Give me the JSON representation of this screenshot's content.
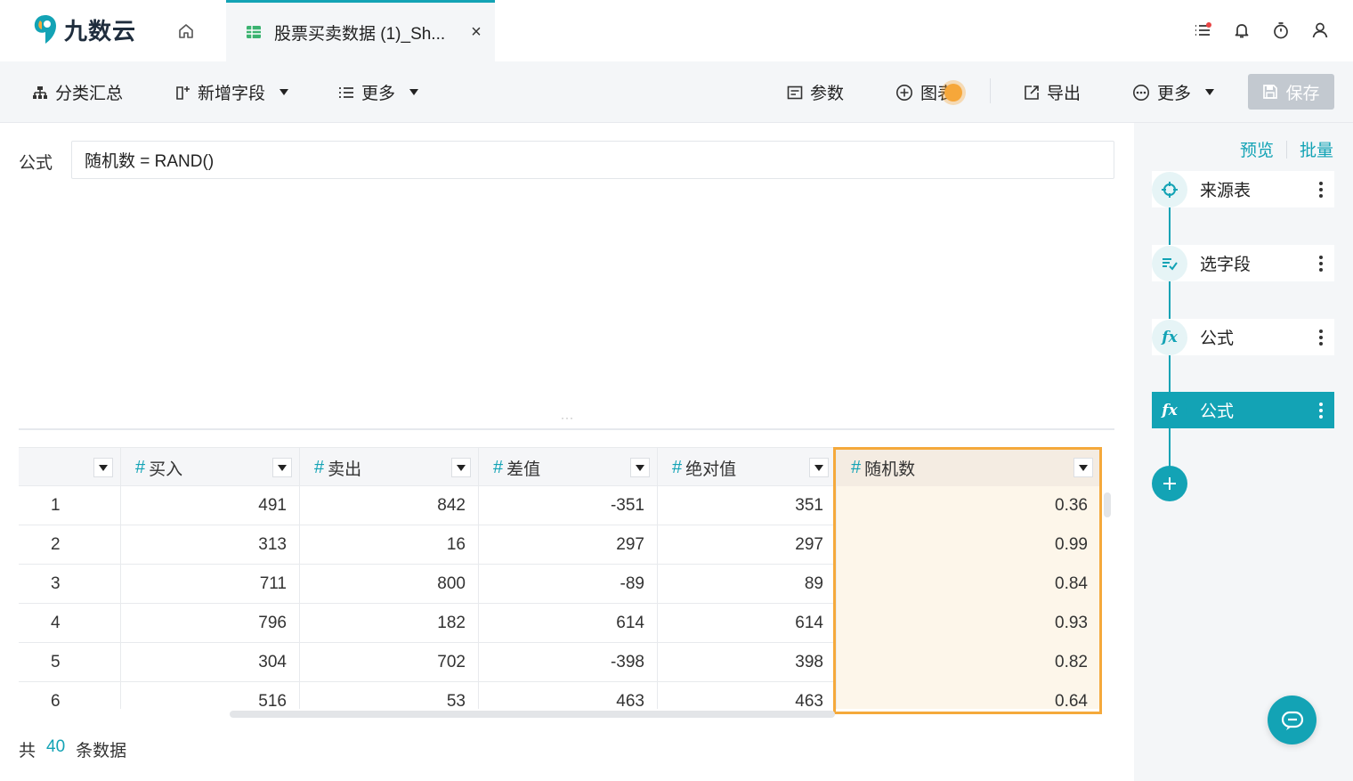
{
  "app": {
    "name": "九数云"
  },
  "tab": {
    "title": "股票买卖数据 (1)_Sh...",
    "close": "×"
  },
  "toolbar": {
    "group": "分类汇总",
    "add_field": "新增字段",
    "more_left": "更多",
    "params": "参数",
    "chart": "图表",
    "export": "导出",
    "more_right": "更多",
    "save": "保存"
  },
  "formula": {
    "label": "公式",
    "value": "随机数 = RAND()"
  },
  "table": {
    "columns": [
      "买入",
      "卖出",
      "差值",
      "绝对值",
      "随机数"
    ],
    "rows": [
      {
        "idx": "1",
        "cells": [
          "491",
          "842",
          "-351",
          "351",
          "0.36"
        ]
      },
      {
        "idx": "2",
        "cells": [
          "313",
          "16",
          "297",
          "297",
          "0.99"
        ]
      },
      {
        "idx": "3",
        "cells": [
          "711",
          "800",
          "-89",
          "89",
          "0.84"
        ]
      },
      {
        "idx": "4",
        "cells": [
          "796",
          "182",
          "614",
          "614",
          "0.93"
        ]
      },
      {
        "idx": "5",
        "cells": [
          "304",
          "702",
          "-398",
          "398",
          "0.82"
        ]
      },
      {
        "idx": "6",
        "cells": [
          "516",
          "53",
          "463",
          "463",
          "0.64"
        ]
      }
    ]
  },
  "footer": {
    "prefix": "共",
    "count": "40",
    "suffix": "条数据"
  },
  "panel": {
    "preview": "预览",
    "batch": "批量",
    "steps": [
      "来源表",
      "选字段",
      "公式",
      "公式"
    ],
    "active_step": 3
  },
  "colors": {
    "accent": "#13a3b5",
    "highlight": "#f5a93b",
    "save_disabled": "#c3c9d0"
  }
}
